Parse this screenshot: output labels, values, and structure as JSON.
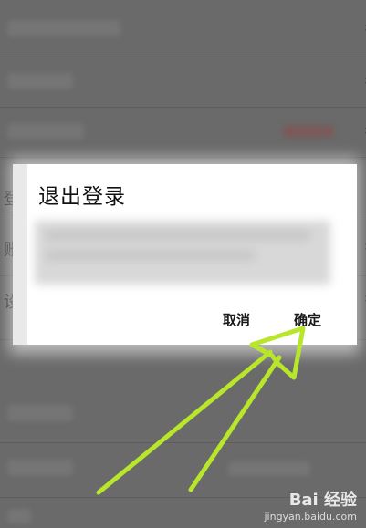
{
  "dialog": {
    "title": "退出登录",
    "cancel_label": "取消",
    "confirm_label": "确定"
  },
  "background": {
    "row_initials": [
      "登",
      "账",
      "设"
    ]
  },
  "watermark": {
    "logo": "Bai 经验",
    "url": "jingyan.baidu.com"
  },
  "annotation": {
    "arrow_color": "#b8e62a"
  }
}
